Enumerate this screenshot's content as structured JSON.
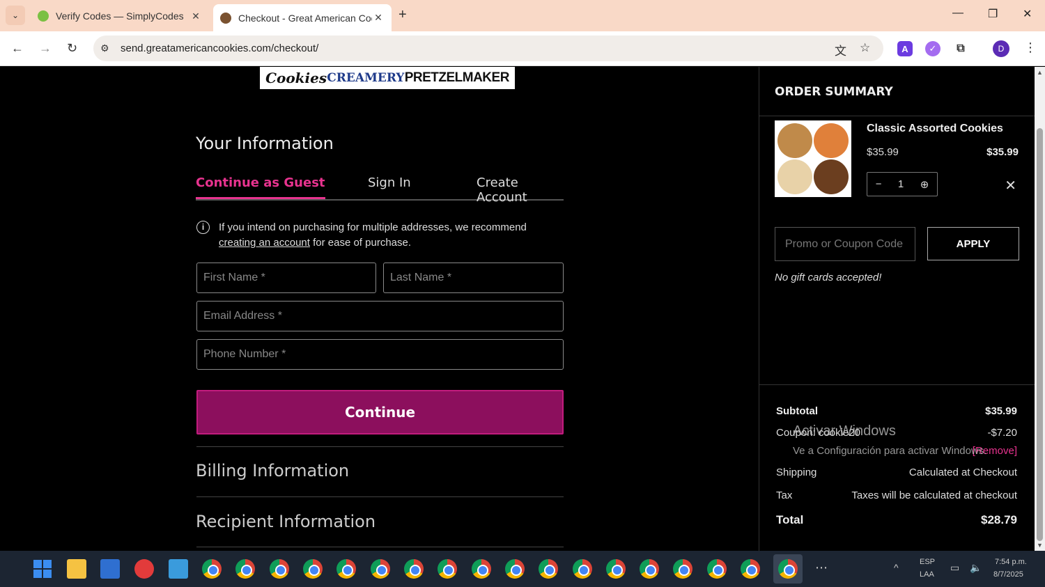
{
  "browser": {
    "tabs": [
      {
        "title": "Verify Codes — SimplyCodes",
        "active": false
      },
      {
        "title": "Checkout - Great American Coo",
        "active": true
      }
    ],
    "url": "send.greatamericancookies.com/checkout/",
    "profile_initial": "D"
  },
  "checkout": {
    "logos": [
      "Cookies",
      "CREAMERY",
      "PRETZELMAKER"
    ],
    "your_information": "Your Information",
    "auth_tabs": [
      "Continue as Guest",
      "Sign In",
      "Create Account"
    ],
    "info_text_1": "If you intend on purchasing for multiple addresses, we recommend",
    "info_link": "creating an account",
    "info_text_2": "for ease of purchase.",
    "placeholders": {
      "first_name": "First Name *",
      "last_name": "Last Name *",
      "email": "Email Address *",
      "phone": "Phone Number *"
    },
    "continue_label": "Continue",
    "billing_title": "Billing Information",
    "recipient_title": "Recipient Information"
  },
  "summary": {
    "title": "ORDER SUMMARY",
    "product": {
      "name": "Classic Assorted Cookies",
      "price": "$35.99",
      "total": "$35.99",
      "qty": "1",
      "minus": "−",
      "plus": "⊕",
      "remove": "✕"
    },
    "promo_placeholder": "Promo or Coupon Code",
    "apply_label": "APPLY",
    "no_gift": "No gift cards accepted!",
    "subtotal_label": "Subtotal",
    "subtotal_value": "$35.99",
    "coupon_label": "Coupon: cookie20",
    "coupon_value": "-$7.20",
    "coupon_remove": "[Remove]",
    "shipping_label": "Shipping",
    "shipping_value": "Calculated at Checkout",
    "tax_label": "Tax",
    "tax_value": "Taxes will be calculated at checkout",
    "total_label": "Total",
    "total_value": "$28.79"
  },
  "watermark": {
    "line1": "Activar Windows",
    "line2": "Ve a Configuración para activar Windows."
  },
  "taskbar": {
    "lang": "ESP",
    "lang2": "LAA",
    "time": "7:54 p.m.",
    "date": "8/7/2025"
  },
  "colors": {
    "accent_pink": "#e8338f",
    "continue_bg": "#8c0f5d",
    "tab_bar": "#f9d9c7"
  }
}
